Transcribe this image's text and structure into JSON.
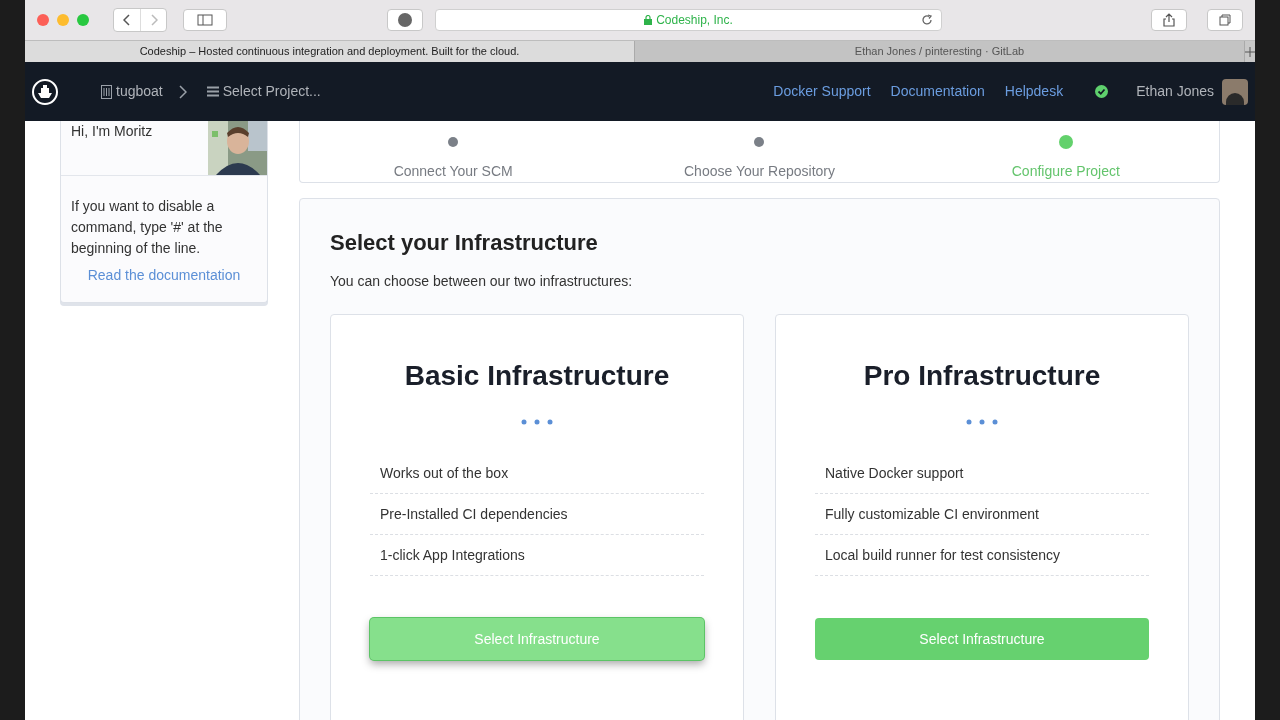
{
  "browser": {
    "url": "Codeship, Inc.",
    "tabs": [
      {
        "label": "Codeship – Hosted continuous integration and deployment. Built for the cloud.",
        "selected": true
      },
      {
        "label": "Ethan Jones / pinteresting · GitLab",
        "selected": false
      }
    ]
  },
  "nav": {
    "organization": "tugboat",
    "project_select": "Select Project...",
    "links": [
      "Docker Support",
      "Documentation",
      "Helpdesk"
    ],
    "user": "Ethan Jones"
  },
  "sidebar": {
    "greeting": "Hi, I'm Moritz",
    "tip": "If you want to disable a command, type '#' at the beginning of the line.",
    "link": "Read the documentation"
  },
  "steps": [
    {
      "label": "Connect Your SCM",
      "selected": false
    },
    {
      "label": "Choose Your Repository",
      "selected": false
    },
    {
      "label": "Configure Project",
      "selected": true
    }
  ],
  "infrastructure": {
    "title": "Select your Infrastructure",
    "subtitle": "You can choose between our two infrastructures:",
    "options": [
      {
        "title": "Basic Infrastructure",
        "features": [
          "Works out of the box",
          "Pre-Installed CI dependencies",
          "1-click App Integrations"
        ],
        "button": "Select Infrastructure",
        "hovered": true
      },
      {
        "title": "Pro Infrastructure",
        "features": [
          "Native Docker support",
          "Fully customizable CI environment",
          "Local build runner for test consistency"
        ],
        "button": "Select Infrastructure",
        "hovered": false
      }
    ]
  }
}
